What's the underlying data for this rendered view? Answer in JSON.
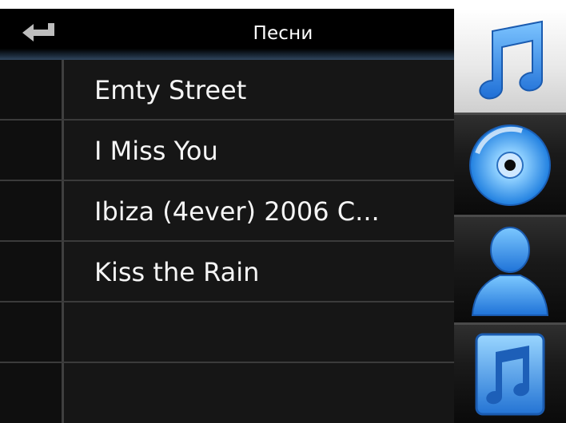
{
  "header": {
    "title": "Песни",
    "back_icon": "return-arrow-icon"
  },
  "songs": [
    {
      "title": "Emty Street"
    },
    {
      "title": "I Miss You"
    },
    {
      "title": "Ibiza (4ever) 2006 C..."
    },
    {
      "title": "Kiss the Rain"
    },
    {
      "title": ""
    },
    {
      "title": ""
    }
  ],
  "nav": {
    "items": [
      {
        "icon": "music-note-icon",
        "state": "active"
      },
      {
        "icon": "cd-disc-icon",
        "state": "inactive"
      },
      {
        "icon": "artist-person-icon",
        "state": "inactive"
      },
      {
        "icon": "playlist-music-icon",
        "state": "inactive"
      }
    ]
  },
  "colors": {
    "background": "#0b0b0b",
    "text": "#f5f5f5",
    "accent_blue": "#2f8fe8",
    "active_tab": "#ffffff"
  }
}
